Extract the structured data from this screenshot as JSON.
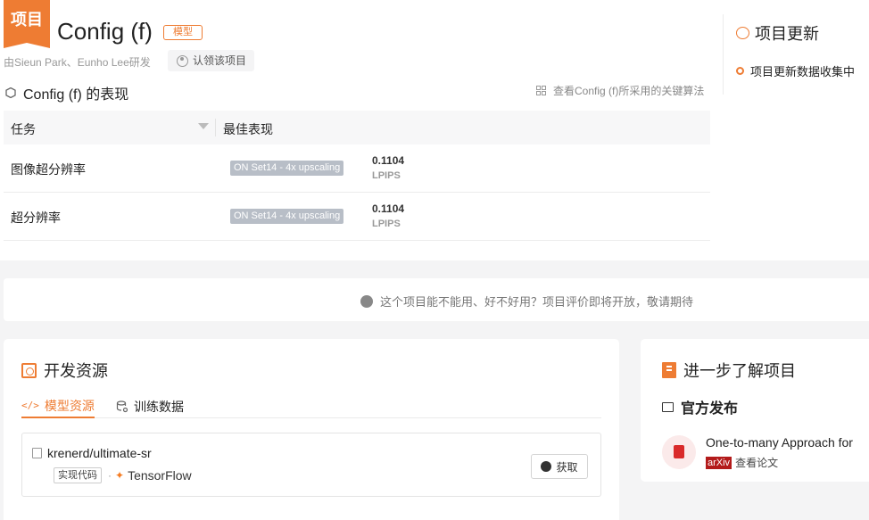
{
  "project": {
    "badge": "项目",
    "title": "Config (f)",
    "type_tag": "模型",
    "authors": "由Sieun Park、Eunho Lee研发",
    "claim_button": "认领该项目"
  },
  "performance": {
    "heading": "Config (f) 的表现",
    "algo_link": "查看Config (f)所采用的关键算法",
    "columns": [
      "任务",
      "最佳表现"
    ],
    "rows": [
      {
        "task": "图像超分辨率",
        "benchmark": "ON Set14 - 4x upscaling",
        "value": "0.1104",
        "metric": "LPIPS"
      },
      {
        "task": "超分辨率",
        "benchmark": "ON Set14 - 4x upscaling",
        "value": "0.1104",
        "metric": "LPIPS"
      }
    ]
  },
  "updates": {
    "heading": "项目更新",
    "item": "项目更新数据收集中"
  },
  "notice": {
    "text": "这个项目能不能用、好不好用？项目评价即将开放，敬请期待"
  },
  "dev_resources": {
    "heading": "开发资源",
    "tabs": [
      {
        "label": "模型资源",
        "icon": "</>"
      },
      {
        "label": "训练数据"
      }
    ],
    "resource": {
      "repo": "krenerd/ultimate-sr",
      "tag": "实现代码",
      "framework": "TensorFlow",
      "button": "获取"
    }
  },
  "learn_more": {
    "heading": "进一步了解项目",
    "official": "官方发布",
    "paper_title": "One-to-many Approach for",
    "paper_source": "arXiv",
    "paper_link": "查看论文"
  },
  "colors": {
    "accent": "#ee7c33",
    "bench_tag": "#b8bec7",
    "arxiv": "#b31b1b"
  }
}
